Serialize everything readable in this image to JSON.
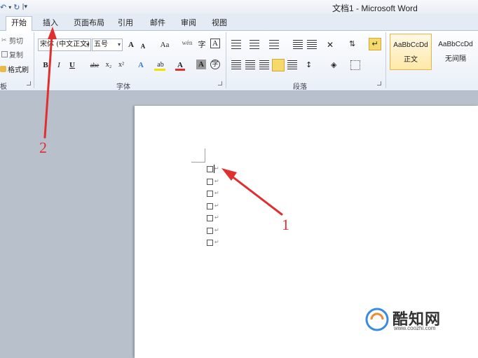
{
  "window": {
    "title": "文档1 - Microsoft Word"
  },
  "quick_access": {
    "undo_icon": "undo-icon",
    "redo_icon": "redo-icon",
    "customize_glyph": "|▾"
  },
  "tabs": [
    {
      "label": "开始",
      "active": true
    },
    {
      "label": "插入",
      "active": false
    },
    {
      "label": "页面布局",
      "active": false
    },
    {
      "label": "引用",
      "active": false
    },
    {
      "label": "邮件",
      "active": false
    },
    {
      "label": "审阅",
      "active": false
    },
    {
      "label": "视图",
      "active": false
    }
  ],
  "clipboard": {
    "cut": "剪切",
    "copy": "复制",
    "format_painter": "格式刷",
    "group_label": "板"
  },
  "font": {
    "font_name": "宋体 (中文正文)",
    "font_size": "五号",
    "grow": "A",
    "shrink": "A",
    "change_case": "Aa",
    "phonetic_glyph": "wén",
    "char_border": "A",
    "bold": "B",
    "italic": "I",
    "underline": "U",
    "strike": "abe",
    "subscript": "x₂",
    "superscript": "x²",
    "text_effect": "A",
    "highlight": "ab",
    "font_color": "A",
    "char_shading": "A",
    "enclosed_char": "字",
    "group_label": "字体"
  },
  "paragraph": {
    "group_label": "段落"
  },
  "styles": [
    {
      "sample": "AaBbCcDd",
      "name": "正文",
      "selected": true
    },
    {
      "sample": "AaBbCcDd",
      "name": "无间隔",
      "selected": false
    }
  ],
  "document": {
    "checkbox_lines": 7,
    "paragraph_mark": "↵"
  },
  "annotations": [
    {
      "label": "1",
      "color": "#e02f2f"
    },
    {
      "label": "2",
      "color": "#e02f2f"
    }
  ],
  "watermark": {
    "name": "酷知网",
    "url": "www.coozhi.com"
  },
  "colors": {
    "accent_highlight": "#f5d96a",
    "annotation_red": "#e02f2f",
    "ribbon_bg": "#eef3fa"
  }
}
